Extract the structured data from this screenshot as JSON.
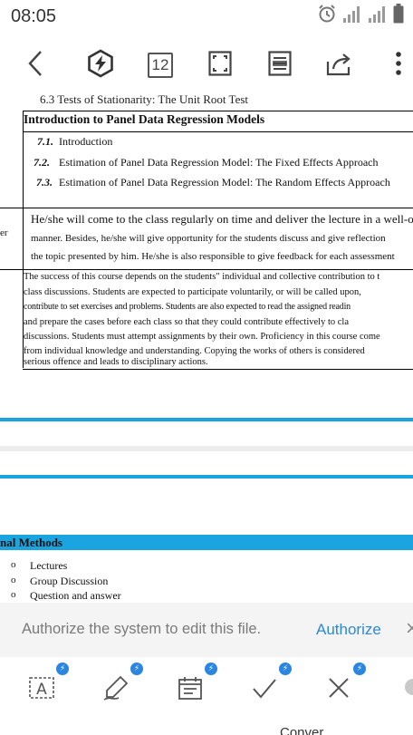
{
  "status_bar": {
    "time": "08:05"
  },
  "toolbar": {
    "page_count": "12"
  },
  "document": {
    "top_cut_text": "6.3     Tests of Stationarity: The Unit Root Test",
    "section_title": "Introduction to Panel Data Regression Models",
    "subsections": [
      {
        "number": "7.1.",
        "text": "Introduction"
      },
      {
        "number": "7.2.",
        "text": "Estimation of Panel Data Regression Model: The Fixed Effects Approach"
      },
      {
        "number": "7.3.",
        "text": "Estimation of Panel Data Regression Model: The Random Effects Approach"
      }
    ],
    "left_fragment": "er",
    "responsibility_lines": [
      "He/she will come to the class regularly on time and deliver the lecture in a well-organiz",
      "manner. Besides, he/she will give opportunity for the students discuss and give reflection",
      "the topic presented by him. He/she is also responsible to give feedback for each assessment"
    ],
    "success_lines": [
      "The success of this course depends on the students\" individual and collective contribution to t",
      "class discussions. Students are expected to participate voluntarily, or will be called upon,",
      "contribute to set exercises and problems. Students are also expected to read the assigned readin",
      "and prepare the cases before each class so that they could contribute effectively to cla",
      "discussions. Students must attempt assignments by their own. Proficiency in this course come",
      "from individual knowledge and understanding. Copying the works of others is considered",
      "serious offence and leads to disciplinary actions."
    ],
    "methods_heading": "nal Methods",
    "methods": [
      "Lectures",
      "Group Discussion",
      "Question and answer"
    ],
    "bullet": "o"
  },
  "authorize_bar": {
    "message": "Authorize the system to edit this file.",
    "button": "Authorize"
  },
  "bottom_tools": {
    "convert_label": "Conver"
  },
  "colors": {
    "accent_blue": "#1ba5e0",
    "authorize_blue": "#2a8ad8",
    "badge_blue": "#2b86e0"
  }
}
